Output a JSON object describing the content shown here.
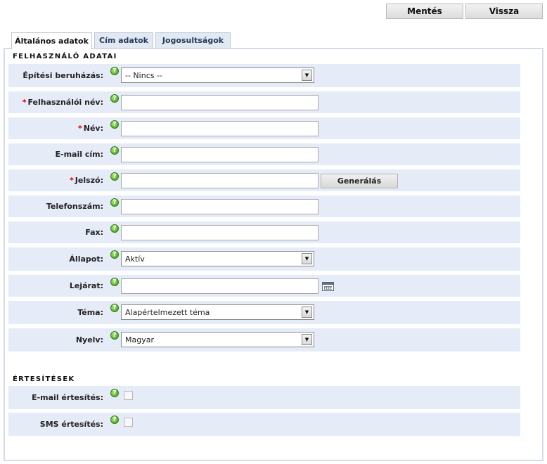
{
  "toolbar": {
    "save_label": "Mentés",
    "back_label": "Vissza"
  },
  "tabs": [
    {
      "label": "Általános adatok",
      "active": true
    },
    {
      "label": "Cím adatok",
      "active": false
    },
    {
      "label": "Jogosultságok",
      "active": false
    }
  ],
  "sections": {
    "user": "FELHASZNÁLÓ ADATAI",
    "notifications": "ÉRTESÍTÉSEK"
  },
  "help_icon": "help-icon",
  "required_marker": "*",
  "fields": {
    "project": {
      "label": "Építési beruházás:",
      "value": "-- Nincs --"
    },
    "username": {
      "label": "Felhasználói név:",
      "value": ""
    },
    "name": {
      "label": "Név:",
      "value": ""
    },
    "email": {
      "label": "E-mail cím:",
      "value": ""
    },
    "password": {
      "label": "Jelszó:",
      "value": "",
      "generate_label": "Generálás"
    },
    "phone": {
      "label": "Telefonszám:",
      "value": ""
    },
    "fax": {
      "label": "Fax:",
      "value": ""
    },
    "status": {
      "label": "Állapot:",
      "value": "Aktív"
    },
    "expiry": {
      "label": "Lejárat:",
      "value": ""
    },
    "theme": {
      "label": "Téma:",
      "value": "Alapértelmezett téma"
    },
    "language": {
      "label": "Nyelv:",
      "value": "Magyar"
    },
    "email_notify": {
      "label": "E-mail értesítés:",
      "checked": false
    },
    "sms_notify": {
      "label": "SMS értesítés:",
      "checked": false
    }
  }
}
